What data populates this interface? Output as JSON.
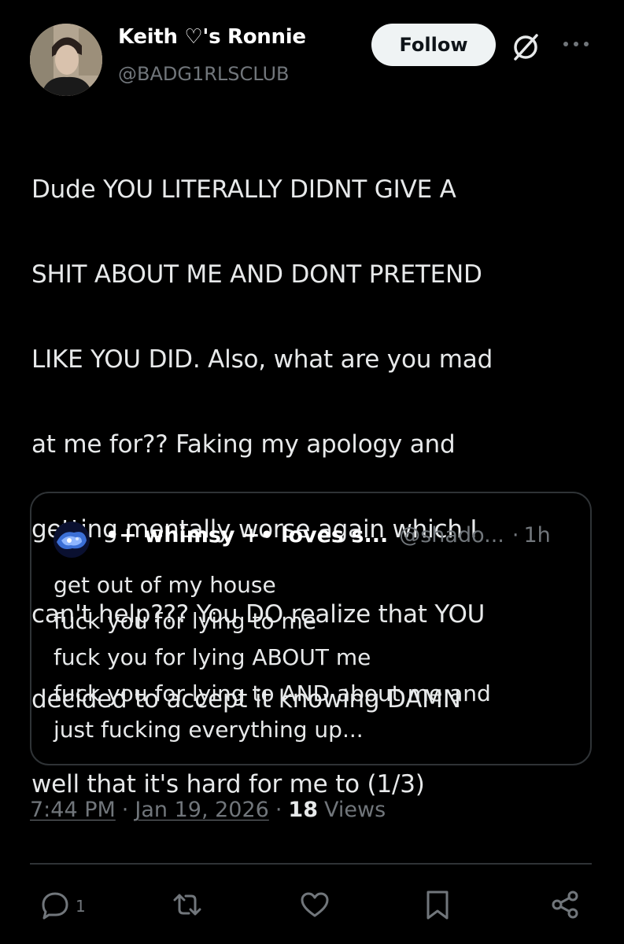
{
  "tweet": {
    "author": {
      "display_name": "Keith ♡'s Ronnie",
      "handle": "@BADG1RLSCLUB"
    },
    "follow_label": "Follow",
    "text_lines": [
      "Dude YOU LITERALLY DIDNT GIVE A",
      "SHIT ABOUT ME AND DONT PRETEND",
      "LIKE YOU DID. Also, what are you mad",
      "at me for?? Faking my apology and",
      "getting mentally worse again which I",
      "can't help??? You DO realize that YOU",
      "decided to accept it knowing DAMN",
      "well that it's hard for me to (1/3)"
    ],
    "quote": {
      "name": "•+ whimsy +• loves s...",
      "handle": "@shado...",
      "separator": "·",
      "time": "1h",
      "lines": [
        "get out of my house",
        "fuck you for lying to me",
        "fuck you for lying ABOUT me",
        "fuck you for lying to AND about me and",
        "just fucking everything up..."
      ]
    },
    "meta": {
      "time": "7:44 PM",
      "date": "Jan 19, 2026",
      "separator": "·",
      "views_count": "18",
      "views_label": "Views"
    },
    "actions": {
      "reply_count": "1"
    }
  },
  "icons": {
    "grok": "grok-icon",
    "more": "more-icon",
    "reply": "reply-icon",
    "retweet": "retweet-icon",
    "like": "heart-icon",
    "bookmark": "bookmark-icon",
    "share": "share-icon"
  },
  "colors": {
    "background": "#000000",
    "text_primary": "#e7e9ea",
    "text_secondary": "#71767b",
    "border": "#2f3336",
    "follow_bg": "#eff3f4"
  }
}
